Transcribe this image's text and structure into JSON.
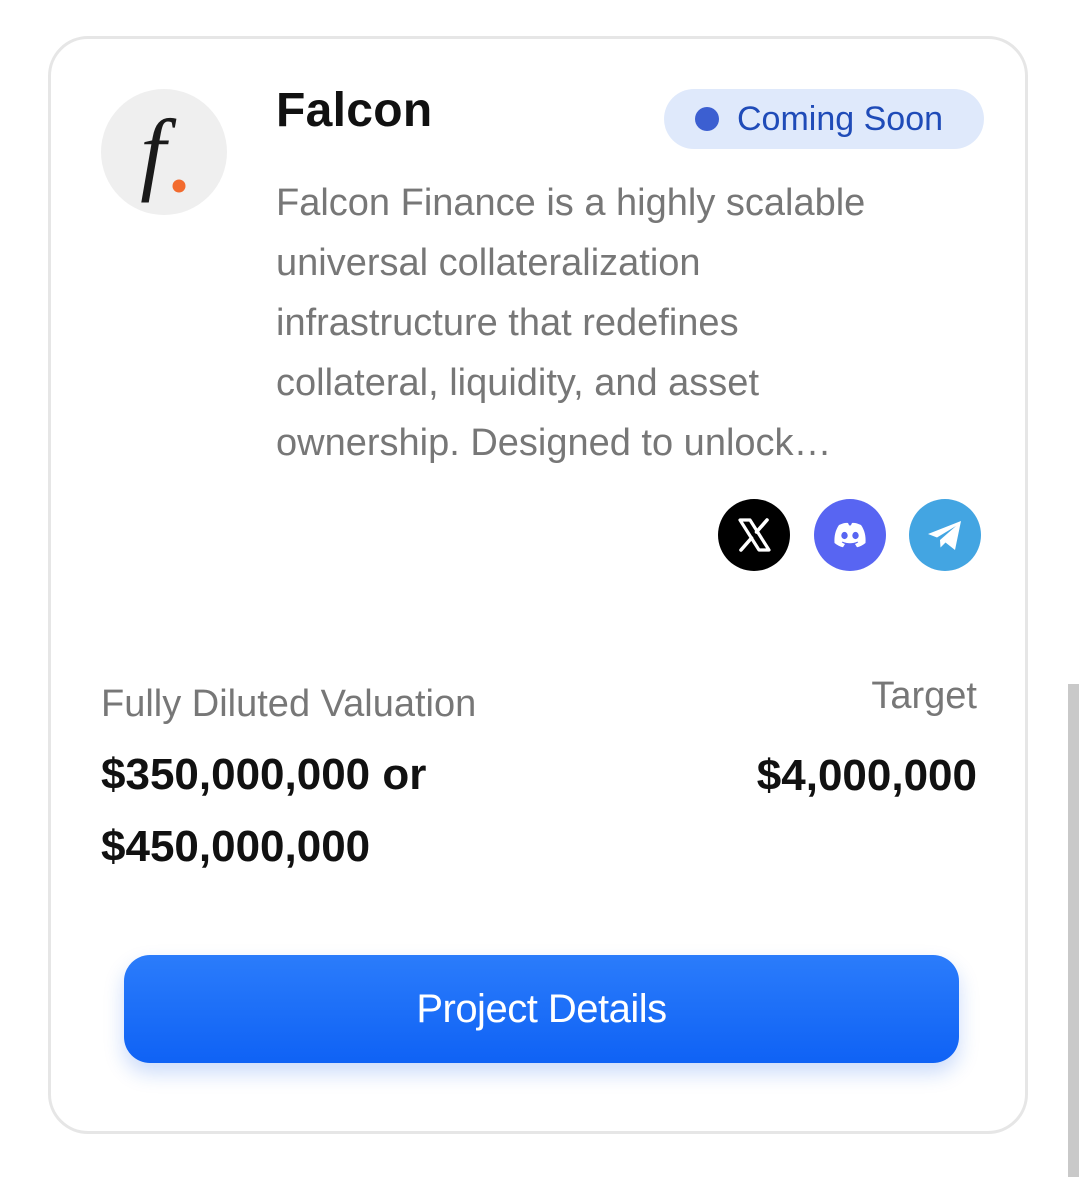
{
  "project": {
    "name": "Falcon",
    "logo_icon": "falcon-f-logo-icon",
    "status": "Coming Soon",
    "status_color": "#3c5fd1",
    "description_lines": [
      "Falcon Finance is a highly scalable",
      "universal collateralization",
      "infrastructure that redefines",
      "collateral, liquidity, and asset",
      "ownership. Designed to unlock…"
    ]
  },
  "social": [
    {
      "icon": "x-twitter-icon",
      "color": "#000000"
    },
    {
      "icon": "discord-icon",
      "color": "#5865f2"
    },
    {
      "icon": "telegram-icon",
      "color": "#43a5e2"
    }
  ],
  "metrics": {
    "fdv_label": "Fully Diluted Valuation",
    "fdv_value": "$350,000,000 or $450,000,000",
    "target_label": "Target",
    "target_value": "$4,000,000"
  },
  "cta": {
    "label": "Project Details",
    "color": "#1668f7"
  }
}
